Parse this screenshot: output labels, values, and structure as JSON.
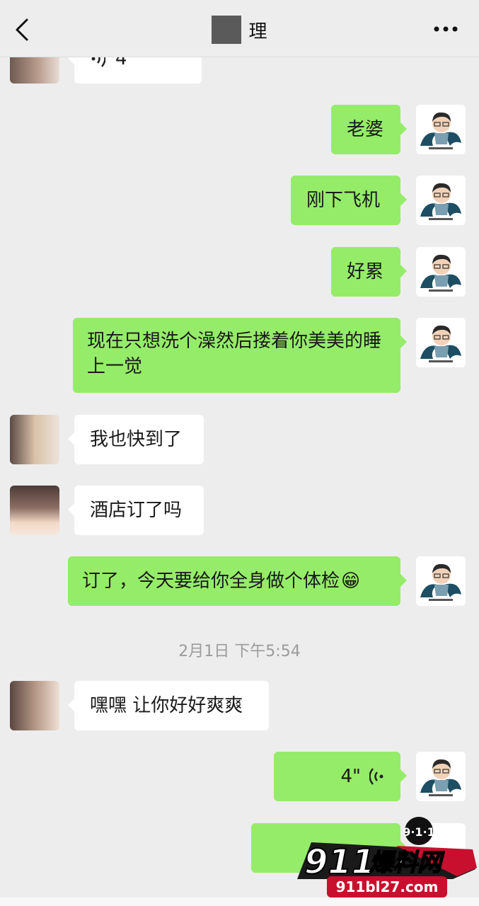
{
  "header": {
    "title": "理"
  },
  "colors": {
    "incoming_bubble": "#ffffff",
    "outgoing_bubble": "#95ec69",
    "background": "#ededed"
  },
  "messages": [
    {
      "side": "in",
      "type": "voice",
      "duration": "4\""
    },
    {
      "side": "out",
      "text": "老婆"
    },
    {
      "side": "out",
      "text": "刚下飞机"
    },
    {
      "side": "out",
      "text": "好累"
    },
    {
      "side": "out",
      "text": "现在只想洗个澡然后搂着你美美的睡上一觉"
    },
    {
      "side": "in",
      "text": "我也快到了"
    },
    {
      "side": "in",
      "text": "酒店订了吗"
    },
    {
      "side": "out",
      "text": "订了，今天要给你全身做个体检",
      "emoji": "😁"
    },
    {
      "side": "in",
      "text": "嘿嘿 让你好好爽爽"
    },
    {
      "side": "out",
      "type": "voice",
      "duration": "4\""
    }
  ],
  "timestamp": "2月1日 下午5:54",
  "watermark": {
    "badge": "9·1·1",
    "brand": "911爆料网",
    "url": "911bl27.com"
  }
}
